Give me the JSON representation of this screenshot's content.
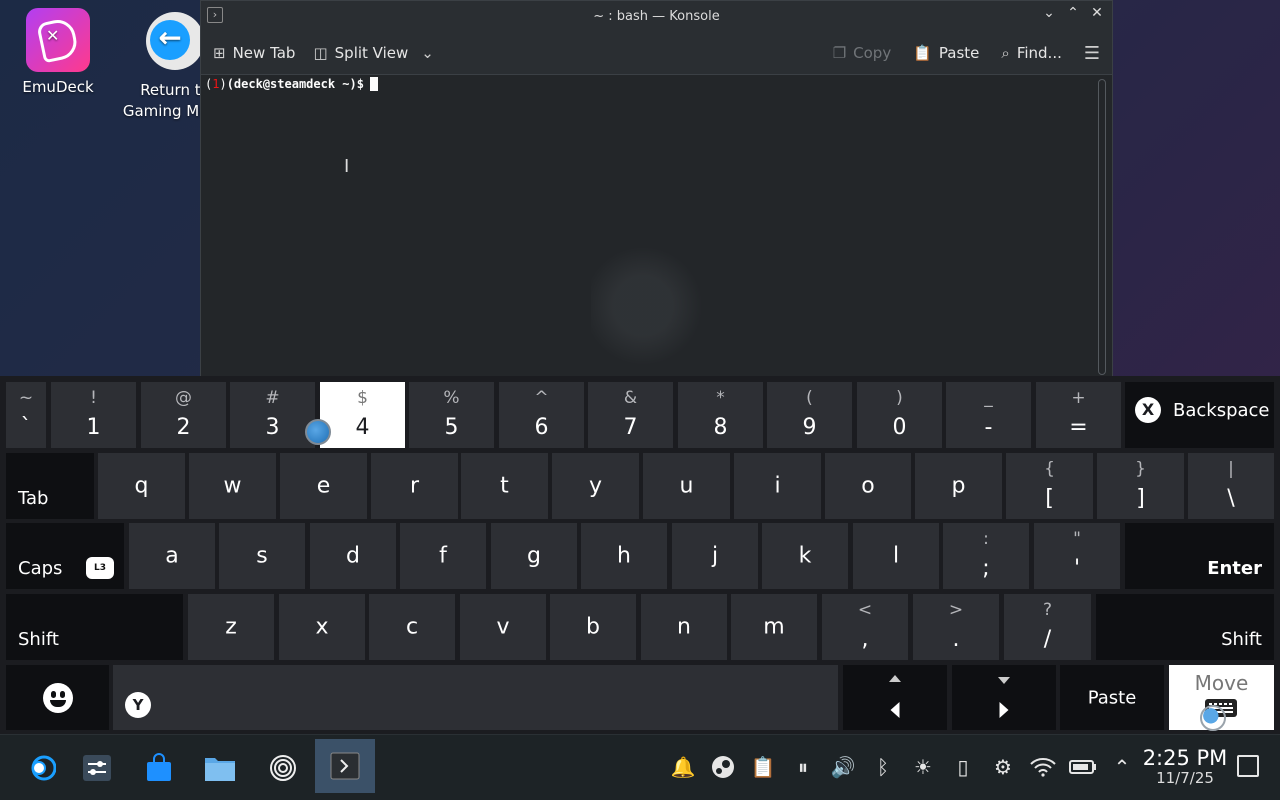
{
  "desktop": {
    "icons": [
      {
        "label": "EmuDeck"
      },
      {
        "label_line1": "Return to",
        "label_line2": "Gaming Mode"
      }
    ]
  },
  "konsole": {
    "title": "~ : bash — Konsole",
    "toolbar": {
      "new_tab": "New Tab",
      "split_view": "Split View",
      "copy": "Copy",
      "paste": "Paste",
      "find": "Find..."
    },
    "prompt": {
      "open": "(",
      "num": "1",
      "close": ")",
      "userhost": "(deck@steamdeck ~)$"
    }
  },
  "keyboard": {
    "row1": [
      {
        "top": "~",
        "bot": "`"
      },
      {
        "top": "!",
        "bot": "1"
      },
      {
        "top": "@",
        "bot": "2"
      },
      {
        "top": "#",
        "bot": "3"
      },
      {
        "top": "$",
        "bot": "4"
      },
      {
        "top": "%",
        "bot": "5"
      },
      {
        "top": "^",
        "bot": "6"
      },
      {
        "top": "&",
        "bot": "7"
      },
      {
        "top": "*",
        "bot": "8"
      },
      {
        "top": "(",
        "bot": "9"
      },
      {
        "top": ")",
        "bot": "0"
      },
      {
        "top": "_",
        "bot": "-"
      },
      {
        "top": "+",
        "bot": "="
      }
    ],
    "backspace": "Backspace",
    "backspace_badge": "X",
    "tab": "Tab",
    "row2": [
      {
        "bot": "q"
      },
      {
        "bot": "w"
      },
      {
        "bot": "e"
      },
      {
        "bot": "r"
      },
      {
        "bot": "t"
      },
      {
        "bot": "y"
      },
      {
        "bot": "u"
      },
      {
        "bot": "i"
      },
      {
        "bot": "o"
      },
      {
        "bot": "p"
      },
      {
        "top": "{",
        "bot": "["
      },
      {
        "top": "}",
        "bot": "]"
      },
      {
        "top": "|",
        "bot": "\\"
      }
    ],
    "caps": "Caps",
    "caps_badge": "L3",
    "row3": [
      {
        "bot": "a"
      },
      {
        "bot": "s"
      },
      {
        "bot": "d"
      },
      {
        "bot": "f"
      },
      {
        "bot": "g"
      },
      {
        "bot": "h"
      },
      {
        "bot": "j"
      },
      {
        "bot": "k"
      },
      {
        "bot": "l"
      },
      {
        "top": ":",
        "bot": ";"
      },
      {
        "top": "\"",
        "bot": "'"
      }
    ],
    "enter": "Enter",
    "shift": "Shift",
    "row4": [
      {
        "bot": "z"
      },
      {
        "bot": "x"
      },
      {
        "bot": "c"
      },
      {
        "bot": "v"
      },
      {
        "bot": "b"
      },
      {
        "bot": "n"
      },
      {
        "bot": "m"
      },
      {
        "top": "<",
        "bot": ","
      },
      {
        "top": ">",
        "bot": "."
      },
      {
        "top": "?",
        "bot": "/"
      }
    ],
    "space_badge": "Y",
    "paste": "Paste",
    "move": "Move"
  },
  "taskbar": {
    "time": "2:25 PM",
    "date": "11/7/25",
    "accent": "#1a9fff"
  }
}
